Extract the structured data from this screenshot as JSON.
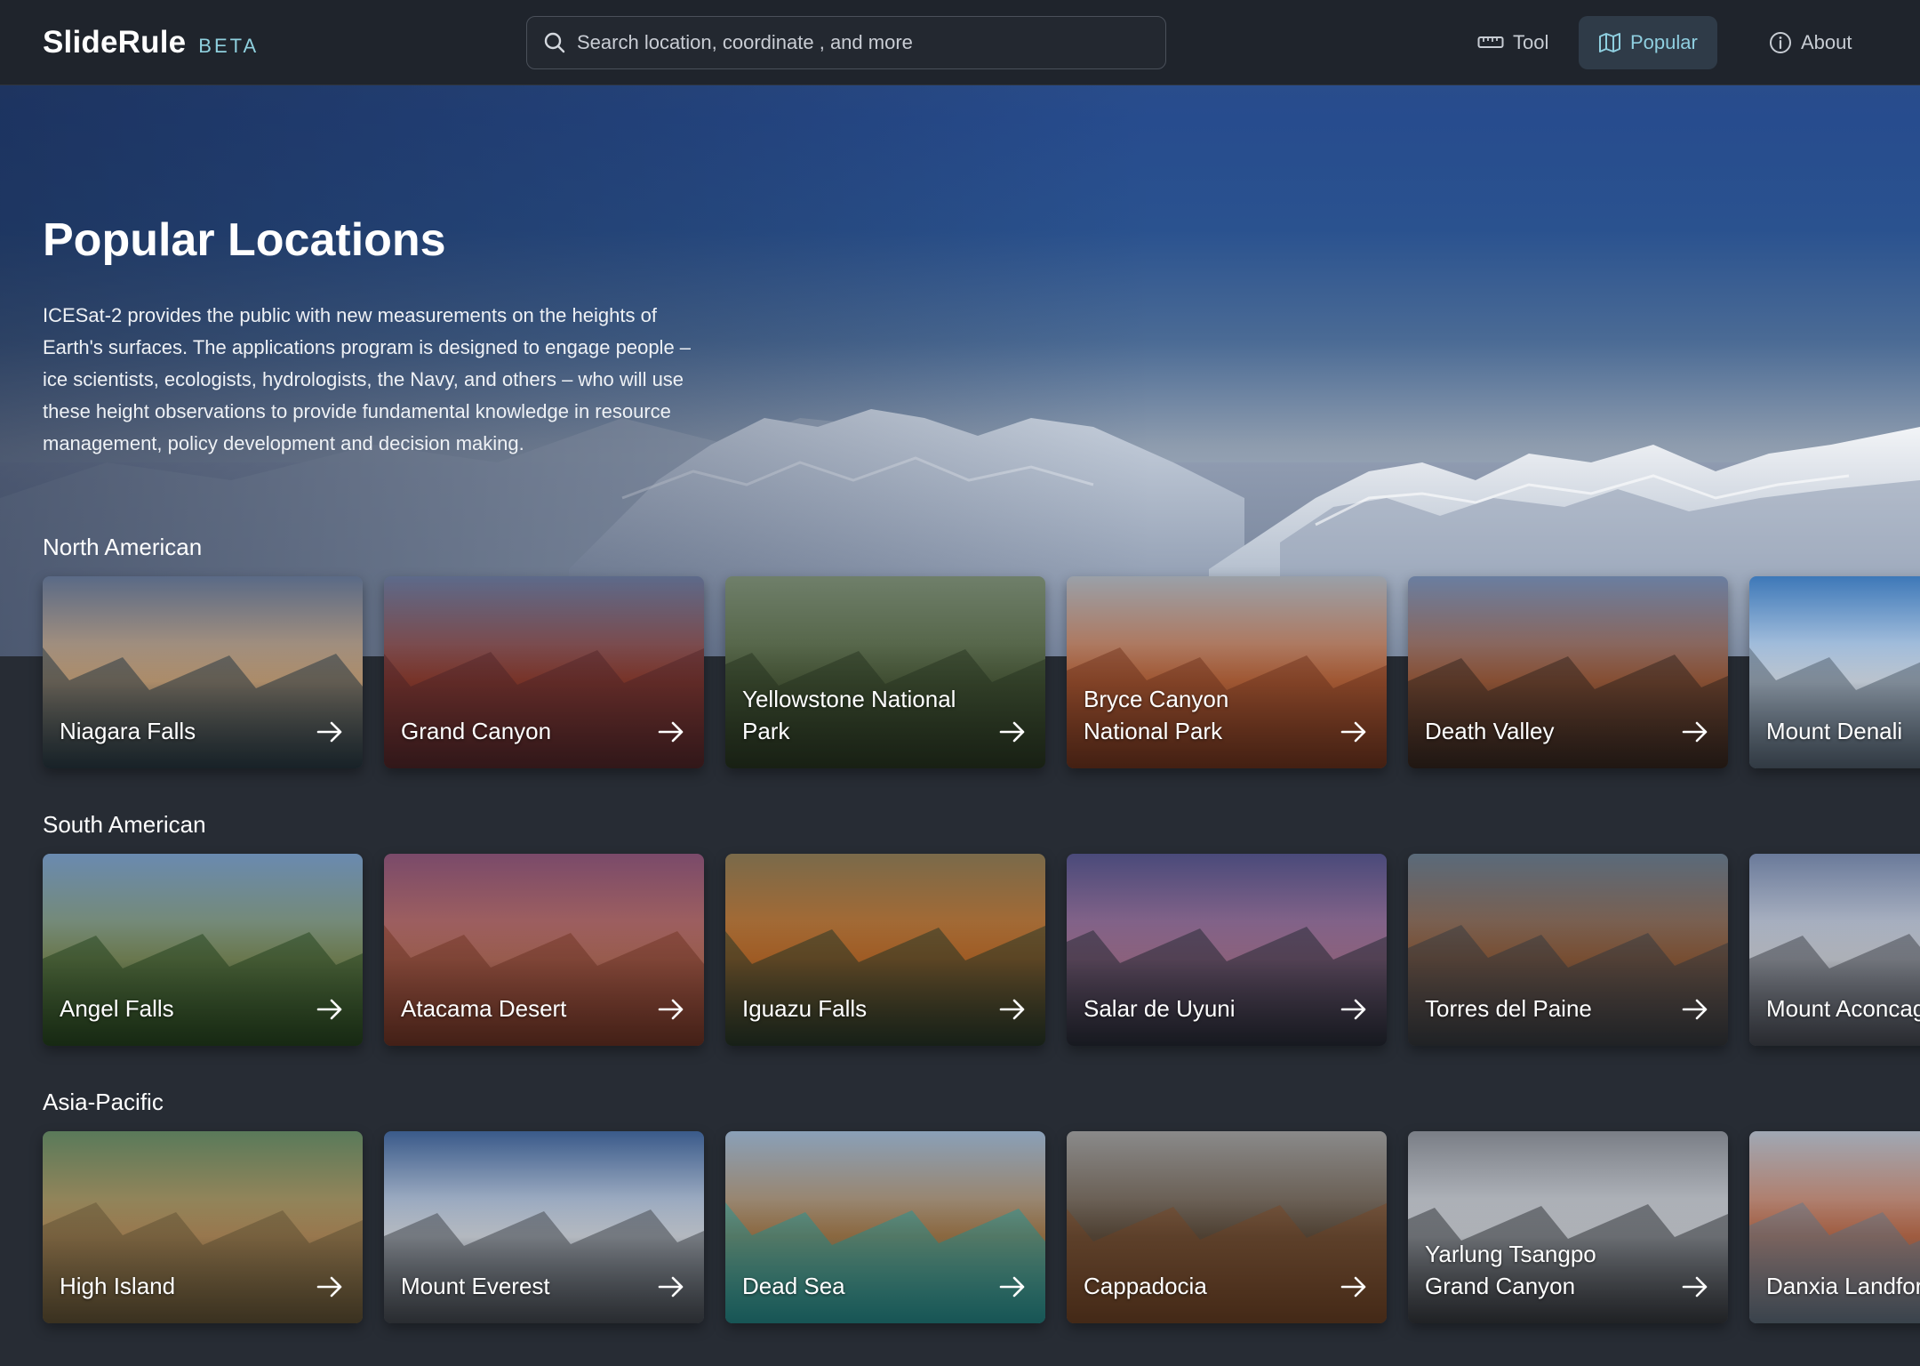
{
  "brand": {
    "name": "SlideRule",
    "tag": "BETA"
  },
  "search": {
    "placeholder": "Search location, coordinate , and more"
  },
  "nav": {
    "items": [
      {
        "label": "Tool",
        "icon": "ruler-icon"
      },
      {
        "label": "Popular",
        "icon": "map-icon",
        "active": true
      },
      {
        "label": "About",
        "icon": "info-icon"
      }
    ]
  },
  "hero": {
    "title": "Popular Locations",
    "description": "ICESat-2 provides the public with new measurements on the heights of Earth's surfaces. The applications program is designed to engage people – ice scientists, ecologists, hydrologists, the Navy, and others – who will use these height observations to provide fundamental knowledge in resource management, policy development and decision making."
  },
  "sections": [
    {
      "title": "North American",
      "locations": [
        {
          "name": "Niagara Falls",
          "colors": [
            "#5a6a86",
            "#c7a27a",
            "#2c3e48"
          ]
        },
        {
          "name": "Grand Canyon",
          "colors": [
            "#5d6a8a",
            "#8a3b2e",
            "#5a2a2e"
          ]
        },
        {
          "name": "Yellowstone National Park",
          "colors": [
            "#6f7f6a",
            "#4a5a3a",
            "#2c3a24"
          ]
        },
        {
          "name": "Bryce Canyon National Park",
          "colors": [
            "#9aa0a8",
            "#b8643a",
            "#7a3a22"
          ]
        },
        {
          "name": "Death Valley",
          "colors": [
            "#6a7ea0",
            "#9a5a3a",
            "#3a2a22"
          ]
        },
        {
          "name": "Mount Denali",
          "colors": [
            "#3d78b8",
            "#d8e2ee",
            "#5a6a7a"
          ]
        }
      ]
    },
    {
      "title": "South American",
      "locations": [
        {
          "name": "Angel Falls",
          "colors": [
            "#6a8ab0",
            "#7a8a5a",
            "#2a4a22"
          ]
        },
        {
          "name": "Atacama Desert",
          "colors": [
            "#7a4a6a",
            "#b06a5a",
            "#7a3a2a"
          ]
        },
        {
          "name": "Iguazu Falls",
          "colors": [
            "#7a6a4a",
            "#b86a2a",
            "#2a3a2a"
          ]
        },
        {
          "name": "Salar de Uyuni",
          "colors": [
            "#4a4a7a",
            "#a07090",
            "#2a2e3a"
          ]
        },
        {
          "name": "Torres del Paine",
          "colors": [
            "#5a6a7a",
            "#8a5a3a",
            "#3a3e44"
          ]
        },
        {
          "name": "Mount Aconcagua",
          "colors": [
            "#6a7a9a",
            "#c8ccd4",
            "#4a4e58"
          ]
        }
      ]
    },
    {
      "title": "Asia-Pacific",
      "locations": [
        {
          "name": "High Island",
          "colors": [
            "#5a7a5a",
            "#b08a5a",
            "#6a5a3a"
          ]
        },
        {
          "name": "Mount Everest",
          "colors": [
            "#3a5a8a",
            "#d0d6de",
            "#4a5058"
          ]
        },
        {
          "name": "Dead Sea",
          "colors": [
            "#8aa0b8",
            "#a0784a",
            "#2a9a9a"
          ]
        },
        {
          "name": "Cappadocia",
          "colors": [
            "#8a8a8a",
            "#5a4a3a",
            "#7a4a2a"
          ]
        },
        {
          "name": "Yarlung Tsangpo Grand Canyon",
          "colors": [
            "#7a7e86",
            "#c8ccd2",
            "#3a3e44"
          ]
        },
        {
          "name": "Danxia Landform",
          "colors": [
            "#a0a8b4",
            "#b86a4a",
            "#6a7a8a"
          ]
        }
      ]
    }
  ]
}
